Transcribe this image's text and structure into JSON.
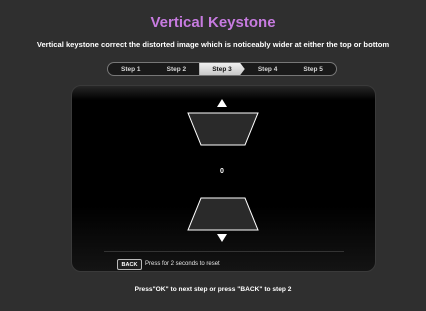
{
  "title": "Vertical Keystone",
  "subtitle": "Vertical keystone correct the distorted image which is noticeably wider at either the top or bottom",
  "steps": [
    {
      "label": "Step 1",
      "active": false
    },
    {
      "label": "Step 2",
      "active": false
    },
    {
      "label": "Step 3",
      "active": true
    },
    {
      "label": "Step 4",
      "active": false
    },
    {
      "label": "Step 5",
      "active": false
    }
  ],
  "keystone": {
    "value": "0"
  },
  "back": {
    "button_label": "BACK",
    "hint": "Press for 2 seconds to reset"
  },
  "footer": "Press\"OK\" to next step or press \"BACK\" to step 2",
  "colors": {
    "title": "#c77be0",
    "background": "#2f2f2f",
    "panel": "#000000"
  },
  "icons": {
    "up": "triangle-up-icon",
    "down": "triangle-down-icon"
  }
}
